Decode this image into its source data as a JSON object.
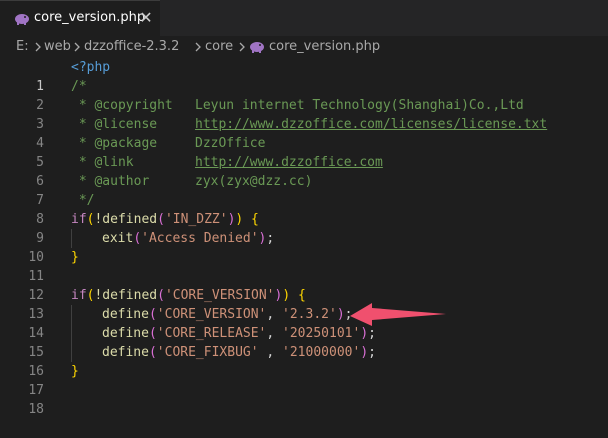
{
  "tab": {
    "label": "core_version.php",
    "close": "✕"
  },
  "breadcrumb": [
    "E:",
    "web",
    "dzzoffice-2.3.2",
    "core",
    "core_version.php"
  ],
  "lines": [
    {
      "n": "1"
    },
    {
      "n": "2"
    },
    {
      "n": "3"
    },
    {
      "n": "4"
    },
    {
      "n": "5"
    },
    {
      "n": "6"
    },
    {
      "n": "7"
    },
    {
      "n": "8"
    },
    {
      "n": "9"
    },
    {
      "n": "10"
    },
    {
      "n": "11"
    },
    {
      "n": "12"
    },
    {
      "n": "13"
    },
    {
      "n": "14"
    },
    {
      "n": "15"
    },
    {
      "n": "16"
    },
    {
      "n": "17"
    },
    {
      "n": "18"
    }
  ],
  "code": {
    "l1": "<?php",
    "l2": "/*",
    "l3_tag": " * @copyright",
    "l3_val": "Leyun internet Technology(Shanghai)Co.,Ltd",
    "l4_tag": " * @license",
    "l4_val": "http://www.dzzoffice.com/licenses/license.txt",
    "l5_tag": " * @package",
    "l5_val": "DzzOffice",
    "l6_tag": " * @link",
    "l6_val": "http://www.dzzoffice.com",
    "l7_tag": " * @author",
    "l7_val": "zyx(zyx@dzz.cc)",
    "l8": " */",
    "kw_if": "if",
    "not_defined": "!defined",
    "str_in_dzz": "'IN_DZZ'",
    "exit": "exit",
    "str_access": "'Access Denied'",
    "define": "define",
    "str_core_version": "'CORE_VERSION'",
    "str_core_release": "'CORE_RELEASE'",
    "str_core_fixbug": "'CORE_FIXBUG'",
    "val_version": "'2.3.2'",
    "val_release": "'20250101'",
    "val_fixbug": "'21000000'"
  },
  "colors": {
    "annotation_arrow": "#f0506e"
  }
}
